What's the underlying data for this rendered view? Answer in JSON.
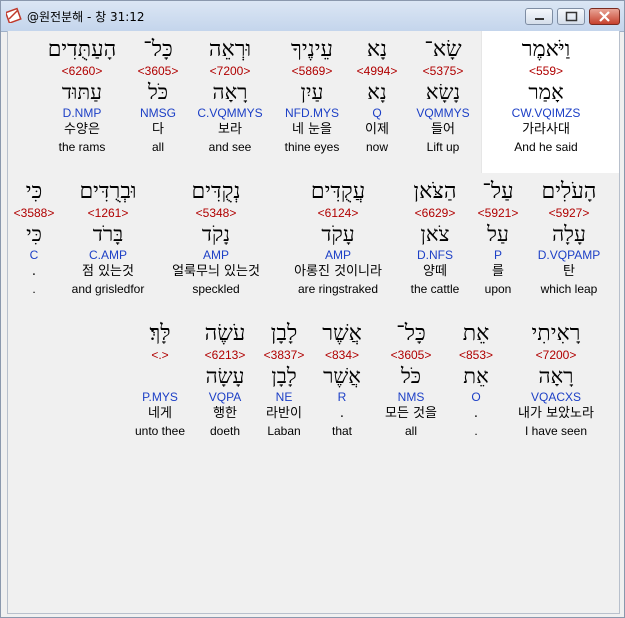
{
  "window": {
    "title": "@원전분해 - 창 31:12"
  },
  "colors": {
    "strong": "#b00000",
    "morph": "#1c3fc6"
  },
  "rows": [
    {
      "words": [
        {
          "heb": "וַיֹּאמֶר",
          "num": "<559>",
          "lemma": "אָמַר",
          "morph": "CW.VQIMZS",
          "kor": "가라사대",
          "eng": "And he said"
        },
        {
          "heb": "שָׂא־",
          "num": "<5375>",
          "lemma": "נָשָׂא",
          "morph": "VQMMYS",
          "kor": "들어",
          "eng": "Lift up"
        },
        {
          "heb": "נָא",
          "num": "<4994>",
          "lemma": "נָא",
          "morph": "Q",
          "kor": "이제",
          "eng": "now"
        },
        {
          "heb": "עֵינֶיךָ",
          "num": "<5869>",
          "lemma": "עַיִן",
          "morph": "NFD.MYS",
          "kor": "네 눈을",
          "eng": "thine eyes"
        },
        {
          "heb": "וּרְאֵה",
          "num": "<7200>",
          "lemma": "רָאָה",
          "morph": "C.VQMMYS",
          "kor": "보라",
          "eng": "and see"
        },
        {
          "heb": "כָּל־",
          "num": "<3605>",
          "lemma": "כֹּל",
          "morph": "NMSG",
          "kor": "다",
          "eng": "all"
        },
        {
          "heb": "הָעַתֻּדִים",
          "num": "<6260>",
          "lemma": "עַתּוּד",
          "morph": "D.NMP",
          "kor": "수양은",
          "eng": "the rams"
        }
      ]
    },
    {
      "words": [
        {
          "heb": "הָעֹלִים",
          "num": "<5927>",
          "lemma": "עָלָה",
          "morph": "D.VQPAMP",
          "kor": "탄",
          "eng": "which leap"
        },
        {
          "heb": "עַל־",
          "num": "<5921>",
          "lemma": "עַל",
          "morph": "P",
          "kor": "를",
          "eng": "upon"
        },
        {
          "heb": "הַצֹּאן",
          "num": "<6629>",
          "lemma": "צֹאן",
          "morph": "D.NFS",
          "kor": "양떼",
          "eng": "the cattle"
        },
        {
          "heb": "עֲקֻדִּים",
          "num": "<6124>",
          "lemma": "עָקֹד",
          "morph": "AMP",
          "kor": "아롱진 것이니라",
          "eng": "are ringstraked"
        },
        {
          "heb": "נְקֻדִּים",
          "num": "<5348>",
          "lemma": "נָקֹד",
          "morph": "AMP",
          "kor": "얼룩무늬 있는것",
          "eng": "speckled"
        },
        {
          "heb": "וּבְרֻדִּים",
          "num": "<1261>",
          "lemma": "בָּרֹד",
          "morph": "C.AMP",
          "kor": "점 있는것",
          "eng": "and grisledfor"
        },
        {
          "heb": "כִּי",
          "num": "<3588>",
          "lemma": "כִּי",
          "morph": "C",
          "kor": ".",
          "eng": "."
        }
      ]
    },
    {
      "words": [
        {
          "heb": "רָאִיתִי",
          "num": "<7200>",
          "lemma": "רָאָה",
          "morph": "VQACXS",
          "kor": "내가 보았노라",
          "eng": "I have seen"
        },
        {
          "heb": "אֵת",
          "num": "<853>",
          "lemma": "אֵת",
          "morph": "O",
          "kor": ".",
          "eng": "."
        },
        {
          "heb": "כָּל־",
          "num": "<3605>",
          "lemma": "כֹּל",
          "morph": "NMS",
          "kor": "모든 것을",
          "eng": "all"
        },
        {
          "heb": "אֲשֶׁר",
          "num": "<834>",
          "lemma": "אֲשֶׁר",
          "morph": "R",
          "kor": ".",
          "eng": "that"
        },
        {
          "heb": "לָבָן",
          "num": "<3837>",
          "lemma": "לָבָן",
          "morph": "NE",
          "kor": "라반이",
          "eng": "Laban"
        },
        {
          "heb": "עֹשֶׂה",
          "num": "<6213>",
          "lemma": "עָשָׂה",
          "morph": "VQPA",
          "kor": "행한",
          "eng": "doeth"
        },
        {
          "heb": "לָּךְ׃",
          "num": "<.>",
          "lemma": "",
          "morph": "P.MYS",
          "kor": "네게",
          "eng": "unto thee"
        }
      ]
    }
  ]
}
